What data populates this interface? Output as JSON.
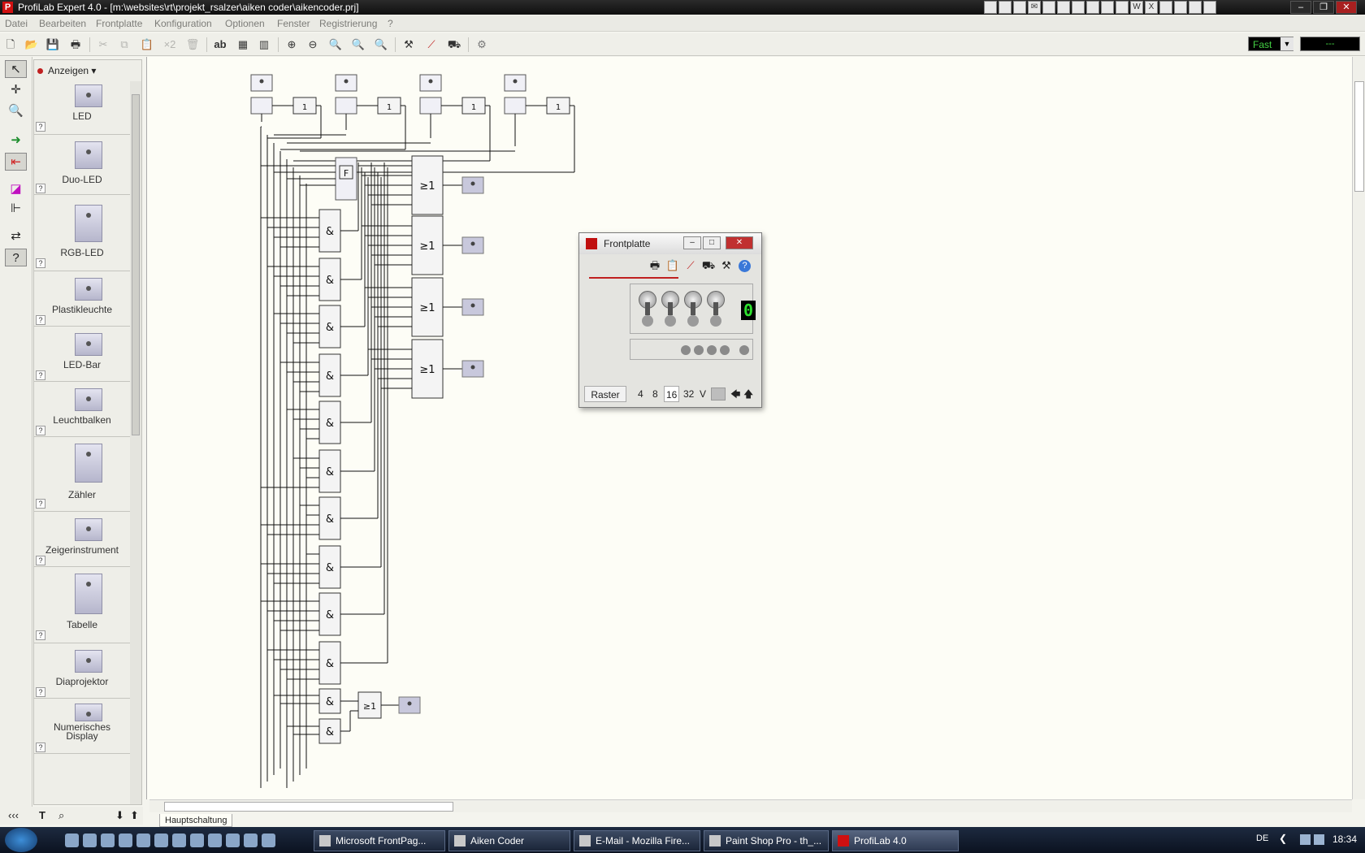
{
  "window": {
    "title": "ProfiLab Expert 4.0 - [m:\\websites\\rt\\projekt_rsalzer\\aiken coder\\aikencoder.prj]"
  },
  "menu": [
    "Datei",
    "Bearbeiten",
    "Frontplatte",
    "Konfiguration",
    "Optionen",
    "Fenster",
    "Registrierung",
    "?"
  ],
  "toolbar": {
    "speed": "Fast",
    "time_display": "---"
  },
  "library": {
    "dropdown_label": "Anzeigen",
    "items": [
      {
        "label": "LED"
      },
      {
        "label": "Duo-LED"
      },
      {
        "label": "RGB-LED"
      },
      {
        "label": "Plastikleuchte"
      },
      {
        "label": "LED-Bar"
      },
      {
        "label": "Leuchtbalken"
      },
      {
        "label": "Zähler"
      },
      {
        "label": "Zeigerinstrument"
      },
      {
        "label": "Tabelle"
      },
      {
        "label": "Diaprojektor"
      },
      {
        "label": "Numerisches Display"
      }
    ],
    "help": "?"
  },
  "sheet_tab": "Hauptschaltung",
  "circuit": {
    "and_label": "&",
    "or_label": "≥1",
    "inv_label": "1",
    "hex_label": "F"
  },
  "frontplatte": {
    "title": "Frontplatte",
    "display_value": "0",
    "raster_label": "Raster",
    "raster_options": [
      "4",
      "8",
      "16",
      "32",
      "V"
    ],
    "raster_selected": "16"
  },
  "taskbar": {
    "tasks": [
      {
        "label": "Microsoft FrontPag..."
      },
      {
        "label": "Aiken Coder"
      },
      {
        "label": "E-Mail - Mozilla Fire..."
      },
      {
        "label": "Paint Shop Pro - th_..."
      },
      {
        "label": "ProfiLab 4.0"
      }
    ],
    "lang": "DE",
    "clock": "18:34"
  }
}
